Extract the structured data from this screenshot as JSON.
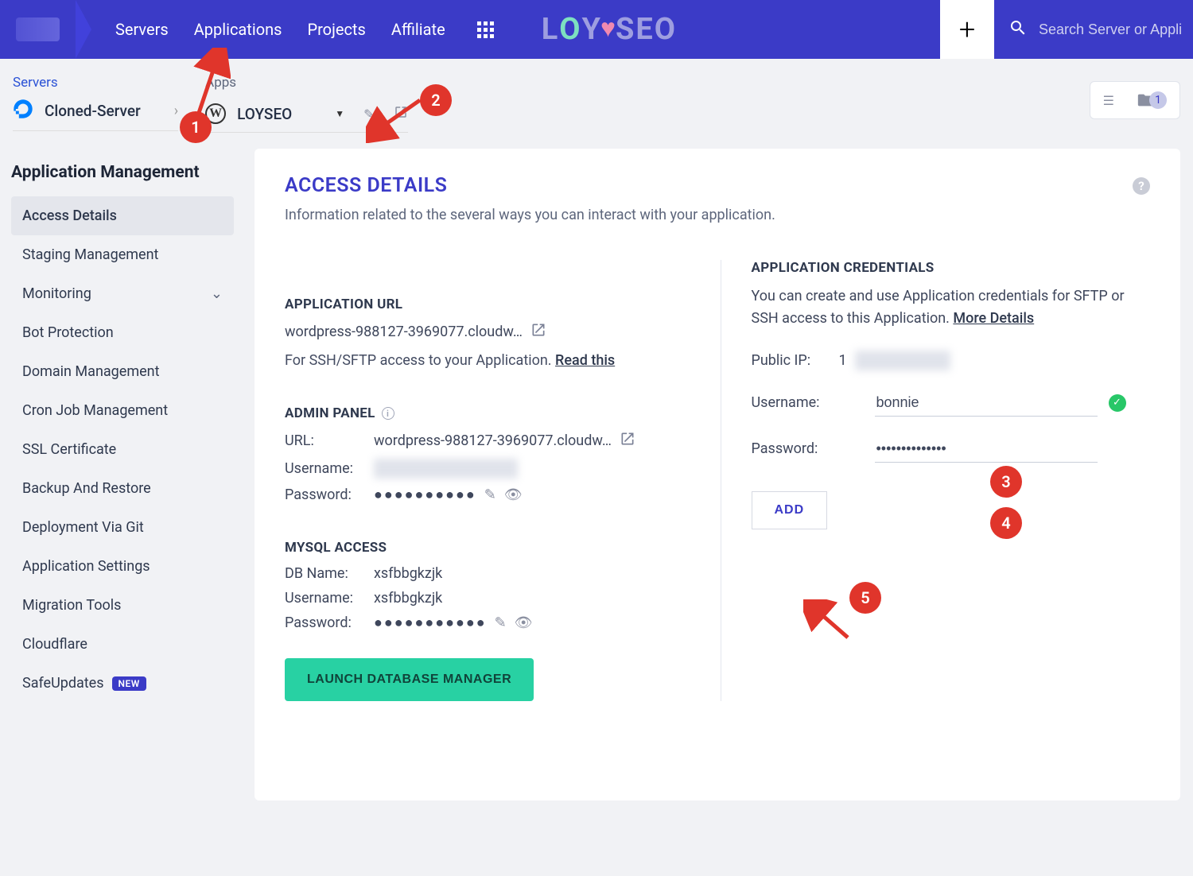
{
  "nav": {
    "items": [
      "Servers",
      "Applications",
      "Projects",
      "Affiliate"
    ],
    "search_placeholder": "Search Server or Applicati",
    "logo": "LOYSEO"
  },
  "breadcrumb": {
    "servers_label": "Servers",
    "server_name": "Cloned-Server",
    "apps_label": "Apps",
    "app_name": "LOYSEO",
    "badge_count": "1"
  },
  "sidebar": {
    "title": "Application Management",
    "items": [
      {
        "label": "Access Details",
        "active": true
      },
      {
        "label": "Staging Management"
      },
      {
        "label": "Monitoring",
        "expandable": true
      },
      {
        "label": "Bot Protection"
      },
      {
        "label": "Domain Management"
      },
      {
        "label": "Cron Job Management"
      },
      {
        "label": "SSL Certificate"
      },
      {
        "label": "Backup And Restore"
      },
      {
        "label": "Deployment Via Git"
      },
      {
        "label": "Application Settings"
      },
      {
        "label": "Migration Tools"
      },
      {
        "label": "Cloudflare"
      },
      {
        "label": "SafeUpdates",
        "badge": "NEW"
      }
    ]
  },
  "main": {
    "title": "ACCESS DETAILS",
    "subtitle": "Information related to the several ways you can interact with your application.",
    "app_url_title": "APPLICATION URL",
    "app_url": "wordpress-988127-3969077.cloudw…",
    "ssh_note": "For SSH/SFTP access to your Application. ",
    "ssh_link": "Read this",
    "admin_title": "ADMIN PANEL",
    "admin_url_label": "URL:",
    "admin_url": "wordpress-988127-3969077.cloudw…",
    "admin_user_label": "Username:",
    "admin_user": "hidden_username_val",
    "admin_pass_label": "Password:",
    "admin_pass": "●●●●●●●●●●",
    "mysql_title": "MYSQL ACCESS",
    "db_name_label": "DB Name:",
    "db_name": "xsfbbgkzjk",
    "db_user_label": "Username:",
    "db_user": "xsfbbgkzjk",
    "db_pass_label": "Password:",
    "db_pass": "●●●●●●●●●●●",
    "launch_btn": "LAUNCH DATABASE MANAGER",
    "cred_title": "APPLICATION CREDENTIALS",
    "cred_note": "You can create and use Application credentials for SFTP or SSH access to this Application. ",
    "cred_link": "More Details",
    "public_ip_label": "Public IP:",
    "public_ip_prefix": "1",
    "public_ip_hidden": "44.100.22.33",
    "username_label": "Username:",
    "username_value": "bonnie",
    "password_label": "Password:",
    "password_value": "●●●●●●●●●●●●●●",
    "add_btn": "ADD"
  },
  "annotations": [
    "1",
    "2",
    "3",
    "4",
    "5"
  ]
}
